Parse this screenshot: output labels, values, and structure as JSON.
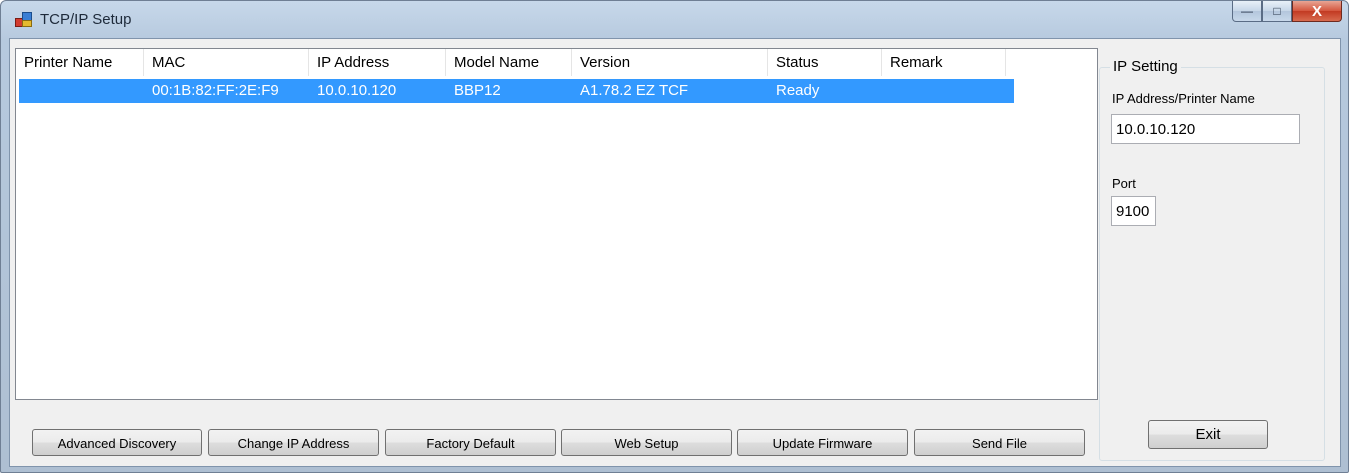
{
  "window": {
    "title": "TCP/IP Setup",
    "close_glyph": "X",
    "minimize_glyph": "—",
    "maximize_glyph": "□"
  },
  "list": {
    "columns": [
      "Printer Name",
      "MAC",
      "IP Address",
      "Model Name",
      "Version",
      "Status",
      "Remark"
    ],
    "rows": [
      {
        "printer_name": "",
        "mac": "00:1B:82:FF:2E:F9",
        "ip": "10.0.10.120",
        "model": "BBP12",
        "version": "A1.78.2 EZ TCF",
        "status": "Ready",
        "remark": ""
      }
    ]
  },
  "ip_setting": {
    "title": "IP Setting",
    "ip_label": "IP Address/Printer Name",
    "ip_value": "10.0.10.120",
    "port_label": "Port",
    "port_value": "9100",
    "exit_label": "Exit"
  },
  "buttons": {
    "advanced_discovery": "Advanced Discovery",
    "change_ip": "Change IP Address",
    "factory_default": "Factory Default",
    "web_setup": "Web Setup",
    "update_firmware": "Update Firmware",
    "send_file": "Send File"
  },
  "icons": {
    "app": "network-setup-icon"
  },
  "colors": {
    "selection": "#3399ff",
    "close_button": "#c23a22"
  }
}
